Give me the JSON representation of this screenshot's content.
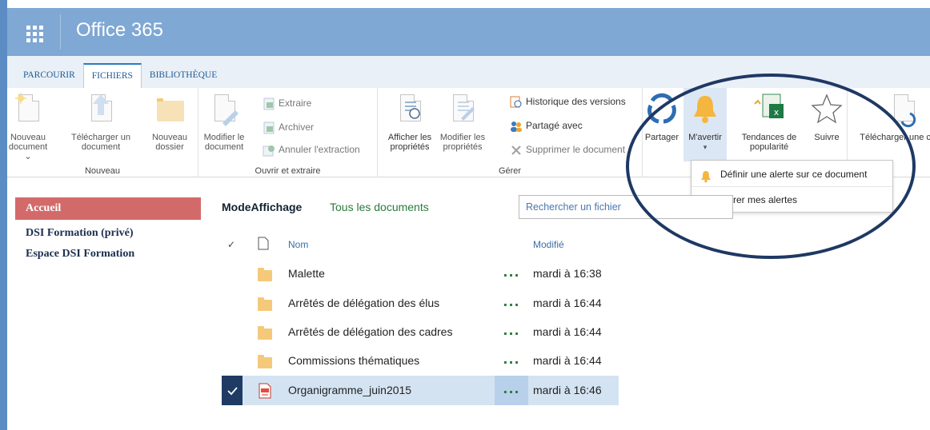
{
  "suite": {
    "title": "Office 365"
  },
  "tabs": [
    "PARCOURIR",
    "FICHIERS",
    "BIBLIOTHÈQUE"
  ],
  "ribbon": {
    "nouveau": {
      "label": "Nouveau",
      "new_doc": "Nouveau document",
      "upload": "Télécharger un document",
      "new_folder": "Nouveau dossier"
    },
    "ouvrir": {
      "label": "Ouvrir et extraire",
      "edit_doc": "Modifier le document",
      "checkout": "Extraire",
      "checkin": "Archiver",
      "discard": "Annuler l'extraction"
    },
    "gerer": {
      "label": "Gérer",
      "view_props": "Afficher les propriétés",
      "edit_props": "Modifier les propriétés",
      "history": "Historique des versions",
      "shared_with": "Partagé avec",
      "delete": "Supprimer le document"
    },
    "partage": {
      "share": "Partager",
      "alert": "M'avertir",
      "popularity": "Tendances de popularité",
      "follow": "Suivre",
      "download": "Télécharger une copie"
    }
  },
  "dropdown": {
    "items": [
      "Définir une alerte sur ce document",
      "Gérer mes alertes"
    ]
  },
  "nav": {
    "items": [
      "Accueil",
      "DSI Formation (privé)",
      "Espace DSI Formation"
    ]
  },
  "view": {
    "mode": "ModeAffichage",
    "all": "Tous les documents"
  },
  "search": {
    "placeholder": "Rechercher un fichier"
  },
  "list": {
    "headers": {
      "name": "Nom",
      "modified": "Modifié"
    },
    "dots": "...",
    "rows": [
      {
        "name": "Malette",
        "modified": "mardi à 16:38",
        "type": "folder-icon"
      },
      {
        "name": "Arrêtés de délégation des élus",
        "modified": "mardi à 16:44",
        "type": "folder-icon"
      },
      {
        "name": "Arrêtés de délégation des cadres",
        "modified": "mardi à 16:44",
        "type": "folder-icon"
      },
      {
        "name": "Commissions thématiques",
        "modified": "mardi à 16:44",
        "type": "folder-icon"
      },
      {
        "name": "Organigramme_juin2015",
        "modified": "mardi à 16:46",
        "type": "pdf-icon",
        "selected": true
      }
    ]
  },
  "colors": {
    "suitebar": "#7fa8d4",
    "accent": "#2b7bc0",
    "nav_active": "#d36a6a",
    "oval": "#1f3864"
  }
}
